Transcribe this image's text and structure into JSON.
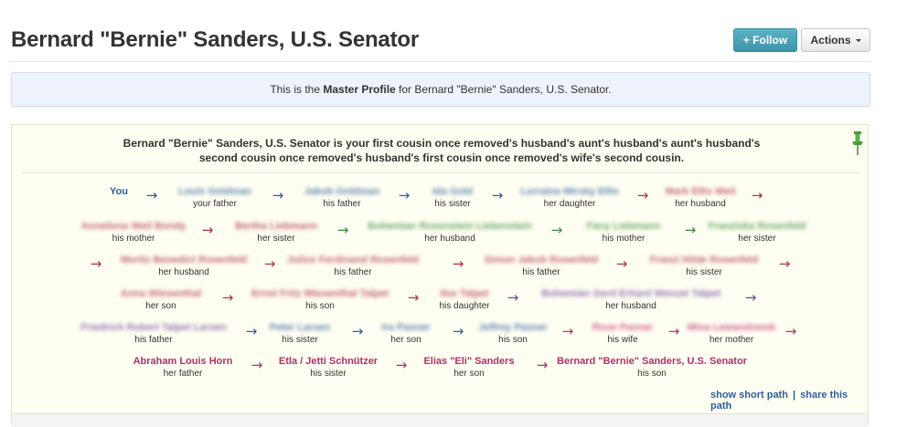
{
  "header": {
    "title": "Bernard \"Bernie\" Sanders, U.S. Senator",
    "follow_label": "+ Follow",
    "actions_label": "Actions"
  },
  "master": {
    "prefix": "This is the ",
    "bold": "Master Profile",
    "suffix": " for Bernard \"Bernie\" Sanders, U.S. Senator."
  },
  "relationship": {
    "line1": "Bernard \"Bernie\" Sanders, U.S. Senator is your first cousin once removed's husband's aunt's husband's aunt's husband's",
    "line2": "second cousin once removed's husband's first cousin once removed's wife's second cousin."
  },
  "path": {
    "nodes": [
      {
        "name": "You",
        "role": "",
        "color": "#2b5f9e",
        "blur": false
      },
      {
        "name": "Louis Goldman",
        "role": "your father",
        "color": "#2b5f9e",
        "blur": true
      },
      {
        "name": "Jakob Goldman",
        "role": "his father",
        "color": "#2b5f9e",
        "blur": true
      },
      {
        "name": "Ida Gold",
        "role": "his sister",
        "color": "#2b5f9e",
        "blur": true
      },
      {
        "name": "Lorraine Mirsky Ellis",
        "role": "her daughter",
        "color": "#2b5f9e",
        "blur": true
      },
      {
        "name": "Mark Ellis Weil",
        "role": "her husband",
        "color": "#b03050",
        "blur": true
      },
      {
        "name": "Anneliese Weil Bondy",
        "role": "his mother",
        "color": "#b03050",
        "blur": true
      },
      {
        "name": "Bertha Liebmann",
        "role": "her sister",
        "color": "#b03050",
        "blur": true
      },
      {
        "name": "Bohemian Rosenstein Liebenstein",
        "role": "her husband",
        "color": "#3a8a3a",
        "blur": true
      },
      {
        "name": "Fany Liebmann",
        "role": "his mother",
        "color": "#3a8a3a",
        "blur": true
      },
      {
        "name": "Franziska Rosenfeld",
        "role": "her sister",
        "color": "#3a8a3a",
        "blur": true
      },
      {
        "name": "Moritz Benedict Rosenfeld",
        "role": "her husband",
        "color": "#b03050",
        "blur": true
      },
      {
        "name": "Julius Ferdinand Rosenfeld",
        "role": "his father",
        "color": "#b03050",
        "blur": true
      },
      {
        "name": "Simon Jakob Rosenfeld",
        "role": "his father",
        "color": "#b03050",
        "blur": true
      },
      {
        "name": "Franzi Hilde Rosenfeld",
        "role": "his sister",
        "color": "#b03050",
        "blur": true
      },
      {
        "name": "Anna Wiesenthal",
        "role": "her son",
        "color": "#b03050",
        "blur": true
      },
      {
        "name": "Ernst Fritz Wiesenthal Talpet",
        "role": "his son",
        "color": "#b03050",
        "blur": true
      },
      {
        "name": "Ilse Talpet",
        "role": "his daughter",
        "color": "#b03050",
        "blur": true
      },
      {
        "name": "Bohemian Gerd Erhard Wenzel Talpet",
        "role": "her husband",
        "color": "#6a4aa0",
        "blur": true
      },
      {
        "name": "Friedrich Robert Talpet Larsen",
        "role": "his father",
        "color": "#6a4aa0",
        "blur": true
      },
      {
        "name": "Peter Larsen",
        "role": "his sister",
        "color": "#2b5f9e",
        "blur": true
      },
      {
        "name": "Ira Pasner",
        "role": "her son",
        "color": "#2b5f9e",
        "blur": true
      },
      {
        "name": "Jeffrey Pasner",
        "role": "his son",
        "color": "#2b5f9e",
        "blur": true
      },
      {
        "name": "Rose Pasner",
        "role": "his wife",
        "color": "#c03070",
        "blur": true
      },
      {
        "name": "Mina Lewandowsk",
        "role": "her mother",
        "color": "#c03070",
        "blur": true
      },
      {
        "name": "Abraham Louis Horn",
        "role": "her father",
        "color": "#b0306a",
        "blur": false
      },
      {
        "name": "Etla / Jetti Schnützer",
        "role": "his sister",
        "color": "#b0306a",
        "blur": false
      },
      {
        "name": "Elias \"Eli\" Sanders",
        "role": "her son",
        "color": "#b0306a",
        "blur": false
      },
      {
        "name": "Bernard \"Bernie\" Sanders, U.S. Senator",
        "role": "his son",
        "color": "#b0306a",
        "blur": false
      }
    ],
    "arrow_glyph": "→"
  },
  "links": {
    "short_path": "show short path",
    "separator": "|",
    "share": "share this path"
  },
  "colors": {
    "blue": "#2b5f9e",
    "red": "#b03050",
    "green": "#3a8a3a",
    "magenta": "#b0306a",
    "purple": "#6a4aa0",
    "follow": "#4aa3b8"
  }
}
